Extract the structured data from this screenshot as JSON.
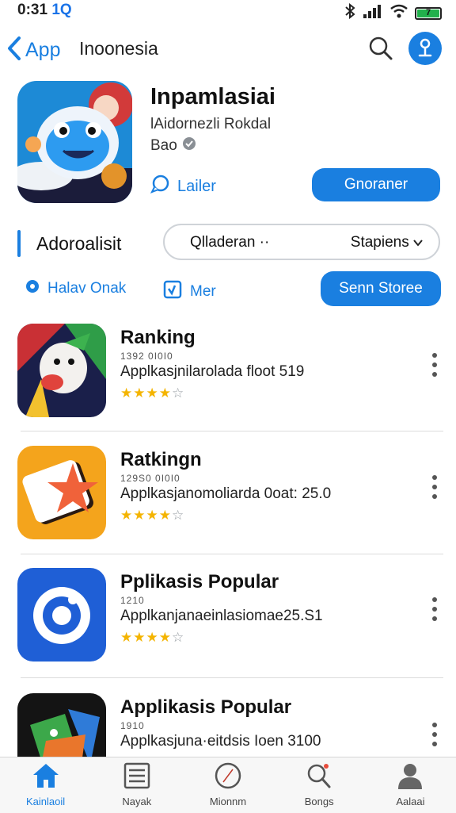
{
  "status_bar": {
    "time": "0:31",
    "badge": "1Q",
    "battery_label": "7"
  },
  "nav": {
    "back_label": "App",
    "title": "Inoonesia"
  },
  "app": {
    "title": "Inpamlasiai",
    "subtitle": "lAidornezli Rokdal",
    "developer": "Bao",
    "link_label": "Lailer",
    "primary_label": "Gnoraner"
  },
  "filter": {
    "label": "Adoroalisit",
    "dropdown_left": "Qlladeran ··",
    "dropdown_right": "Stapiens",
    "option_a": "Halav Onak",
    "option_b": "Mer",
    "store_button": "Senn Storee"
  },
  "list": [
    {
      "name": "Ranking",
      "meta": "1392 0I0I0",
      "desc": "Applkasjnilarolada floot 519",
      "rating": 4
    },
    {
      "name": "Ratkingn",
      "meta": "129S0 0I0I0",
      "desc": "Applkasjanomoliarda 0oat: 25.0",
      "rating": 4
    },
    {
      "name": "Pplikasis Popular",
      "meta": "1210",
      "desc": "Applkanjanaeinlasiomaе25.S1",
      "rating": 4
    },
    {
      "name": "Applikasis Popular",
      "meta": "1910",
      "desc": "Applkasjuna·eitdsis Ioen 3100",
      "rating": 4
    }
  ],
  "tabs": [
    {
      "label": "Kainlaoil",
      "icon": "home-icon"
    },
    {
      "label": "Nayak",
      "icon": "list-icon"
    },
    {
      "label": "Mionnm",
      "icon": "compass-icon"
    },
    {
      "label": "Bongs",
      "icon": "search-icon"
    },
    {
      "label": "Aalaai",
      "icon": "person-icon"
    }
  ],
  "colors": {
    "accent": "#1a7fe0",
    "star": "#f4b400",
    "battery": "#22b14c"
  }
}
